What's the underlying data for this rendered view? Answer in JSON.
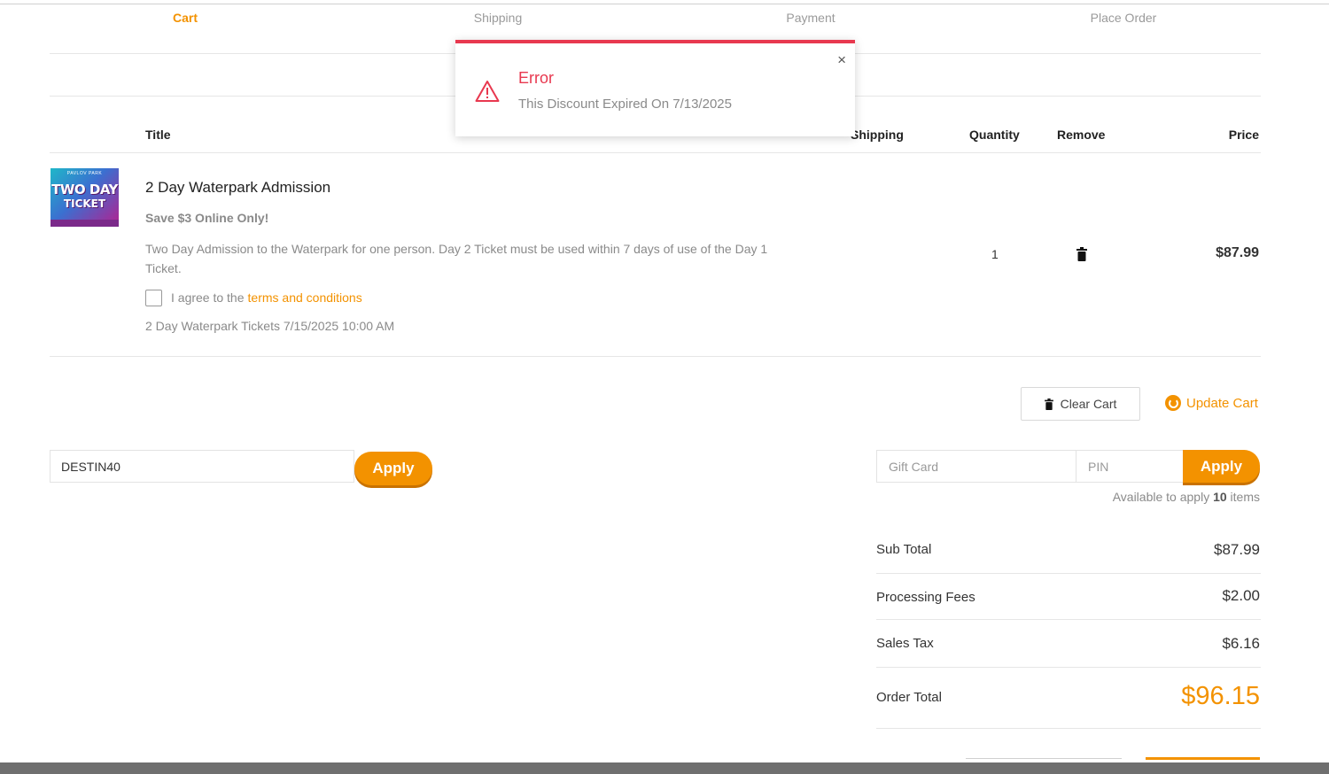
{
  "steps": [
    "Cart",
    "Shipping",
    "Payment",
    "Place Order"
  ],
  "table_headers": {
    "title": "Title",
    "shipping": "Shipping",
    "quantity": "Quantity",
    "remove": "Remove",
    "price": "Price"
  },
  "item": {
    "thumb_small": "PAVLOV PARK",
    "thumb_line1": "TWO DAY",
    "thumb_line2": "TICKET",
    "title": "2 Day Waterpark Admission",
    "subtitle": "Save $3 Online Only!",
    "description": "Two Day Admission to the Waterpark for one person.  Day 2 Ticket must be used within 7 days of use of the Day 1 Ticket.",
    "agree_text": "I agree to the",
    "agree_link": "terms and conditions",
    "date": "2 Day Waterpark Tickets 7/15/2025 10:00 AM",
    "quantity": "1",
    "price": "$87.99"
  },
  "actions": {
    "clear_cart": "Clear Cart",
    "update_cart": "Update Cart"
  },
  "discount": {
    "value": "DESTIN40",
    "apply": "Apply"
  },
  "gift": {
    "card_placeholder": "Gift Card",
    "pin_placeholder": "PIN",
    "apply": "Apply",
    "avail_prefix": "Available to apply",
    "avail_count": "10",
    "avail_suffix": "items"
  },
  "totals": {
    "sub_total_label": "Sub Total",
    "sub_total": "$87.99",
    "fees_label": "Processing Fees",
    "fees": "$2.00",
    "tax_label": "Sales Tax",
    "tax": "$6.16",
    "order_total_label": "Order Total",
    "order_total": "$96.15"
  },
  "toast": {
    "title": "Error",
    "message": "This Discount Expired On 7/13/2025",
    "close": "×"
  },
  "colors": {
    "accent": "#f39200",
    "error": "#e8384f"
  }
}
